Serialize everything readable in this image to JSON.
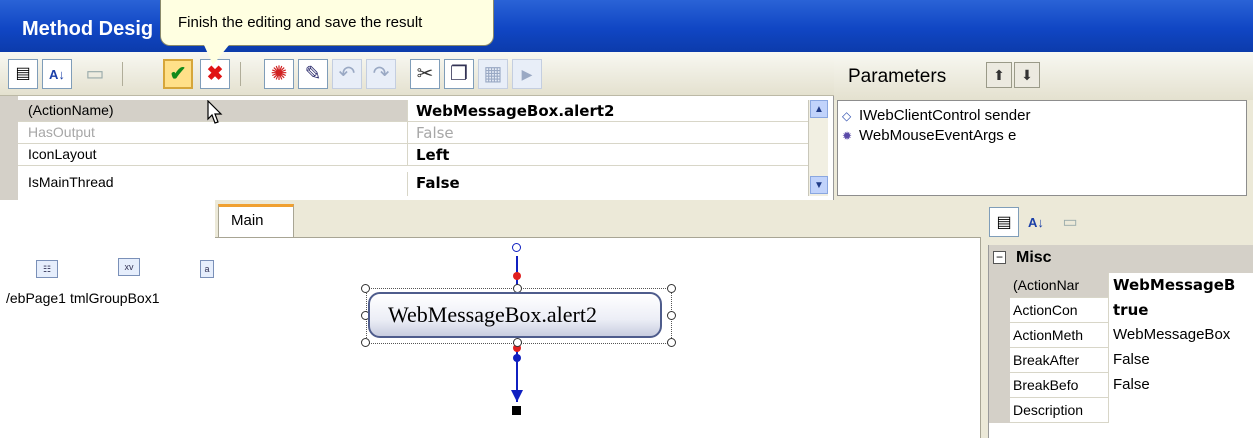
{
  "window": {
    "title": "Method Desig"
  },
  "tooltip": {
    "text": "Finish the editing and save the result"
  },
  "toolbar": {
    "buttons": [
      {
        "name": "categorized-icon",
        "glyph": "▤"
      },
      {
        "name": "sort-az-icon",
        "glyph": "A↓"
      },
      {
        "name": "property-pages-icon",
        "glyph": "▭"
      },
      {
        "name": "ok-checkmark-icon",
        "glyph": "✔"
      },
      {
        "name": "cancel-x-icon",
        "glyph": "✖"
      },
      {
        "name": "sun-icon",
        "glyph": "✺"
      },
      {
        "name": "magic-wand-icon",
        "glyph": "✎"
      },
      {
        "name": "undo-icon",
        "glyph": "↶"
      },
      {
        "name": "redo-icon",
        "glyph": "↷"
      },
      {
        "name": "cut-icon",
        "glyph": "✂"
      },
      {
        "name": "copy-icon",
        "glyph": "❐"
      },
      {
        "name": "paste-icon",
        "glyph": "▦"
      },
      {
        "name": "run-icon",
        "glyph": "▶"
      }
    ]
  },
  "properties": {
    "rows": [
      {
        "name": "(ActionName)",
        "value": "WebMessageBox.alert2",
        "selected": true,
        "gray": false
      },
      {
        "name": "HasOutput",
        "value": "False",
        "selected": false,
        "gray": true
      },
      {
        "name": "IconLayout",
        "value": "Left",
        "selected": false,
        "gray": false
      },
      {
        "name": "IsMainThread",
        "value": "False",
        "selected": false,
        "gray": false
      }
    ]
  },
  "parameters": {
    "label": "Parameters",
    "items": [
      {
        "icon": "interface-icon",
        "text": "IWebClientControl sender"
      },
      {
        "icon": "gear-class-icon",
        "text": "WebMouseEventArgs e"
      }
    ]
  },
  "components": [
    {
      "label": "/ebPage1",
      "icon_text": "☷"
    },
    {
      "label": "tmlGroupBox1",
      "icon_text": "xv"
    },
    {
      "label": "",
      "icon_text": "a"
    }
  ],
  "designer": {
    "tab": "Main",
    "node_label": "WebMessageBox.alert2"
  },
  "right_props": {
    "category": "Misc",
    "rows": [
      {
        "name": "(ActionNar",
        "value": "WebMessageB",
        "bold": true
      },
      {
        "name": "ActionCon",
        "value": "true",
        "bold": true
      },
      {
        "name": "ActionMeth",
        "value": "WebMessageBox",
        "bold": false
      },
      {
        "name": "BreakAfter",
        "value": "False",
        "bold": false
      },
      {
        "name": "BreakBefo",
        "value": "False",
        "bold": false
      },
      {
        "name": "Description",
        "value": "",
        "bold": false
      }
    ]
  },
  "colors": {
    "title_bar": "#1046c4",
    "tooltip_bg": "#ffffe1",
    "ok_green": "#138a1b",
    "cancel_red": "#e01414",
    "flow_blue": "#1020c0",
    "flow_red": "#e02020",
    "tab_accent": "#f0a030"
  }
}
